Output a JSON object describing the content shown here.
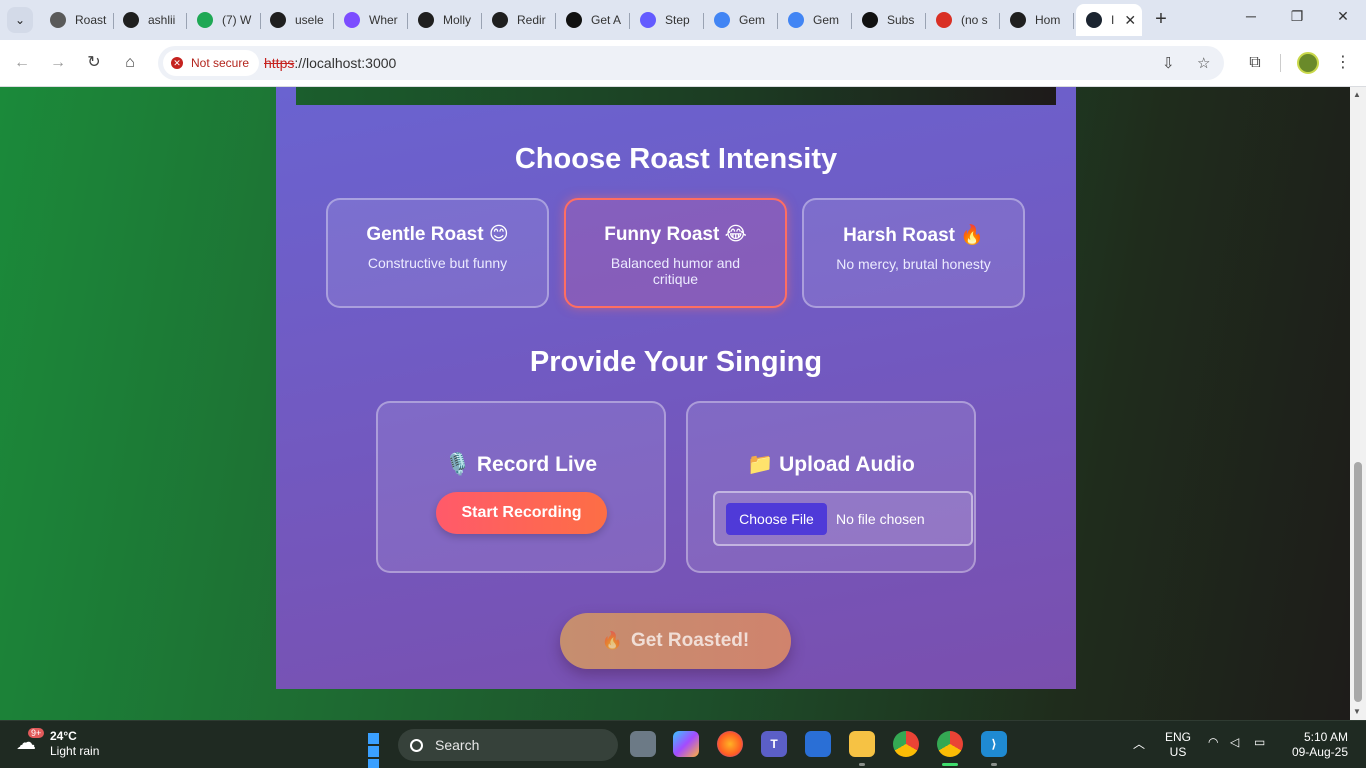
{
  "browser": {
    "tabs": [
      {
        "label": "Roast",
        "icon": "openai-icon",
        "color": "#5a5a5a"
      },
      {
        "label": "ashlii",
        "icon": "github-icon",
        "color": "#1f1f1f"
      },
      {
        "label": "(7) W",
        "icon": "whatsapp-icon",
        "color": "#1fa855"
      },
      {
        "label": "usele",
        "icon": "github-icon",
        "color": "#1f1f1f"
      },
      {
        "label": "Wher",
        "icon": "cursor-icon",
        "color": "#7c4dff"
      },
      {
        "label": "Molly",
        "icon": "spotify-icon",
        "color": "#1f1f1f"
      },
      {
        "label": "Redir",
        "icon": "spotify-icon",
        "color": "#1f1f1f"
      },
      {
        "label": "Get A",
        "icon": "get-icon",
        "color": "#111111"
      },
      {
        "label": "Step",
        "icon": "stripe-icon",
        "color": "#635bff"
      },
      {
        "label": "Gem",
        "icon": "google-icon",
        "color": "#4285f4"
      },
      {
        "label": "Gem",
        "icon": "google-icon",
        "color": "#4285f4"
      },
      {
        "label": "Subs",
        "icon": "substack-icon",
        "color": "#111111"
      },
      {
        "label": "(no s",
        "icon": "gmail-icon",
        "color": "#d93025"
      },
      {
        "label": "Hom",
        "icon": "spotify-icon",
        "color": "#1f1f1f"
      },
      {
        "label": "I",
        "icon": "react-icon",
        "color": "#1b2430",
        "active": true
      }
    ],
    "security_chip": "Not secure",
    "url_scheme": "https",
    "url_rest": "://localhost:3000"
  },
  "page": {
    "intensity_title": "Choose Roast Intensity",
    "intensity_options": [
      {
        "name": "Gentle Roast",
        "emoji": "😊",
        "desc": "Constructive but funny",
        "selected": false
      },
      {
        "name": "Funny Roast",
        "emoji": "😂",
        "desc": "Balanced humor and critique",
        "selected": true
      },
      {
        "name": "Harsh Roast",
        "emoji": "🔥",
        "desc": "No mercy, brutal honesty",
        "selected": false
      }
    ],
    "singing_title": "Provide Your Singing",
    "record": {
      "emoji": "🎙️",
      "title": "Record Live",
      "button": "Start Recording"
    },
    "upload": {
      "emoji": "📁",
      "title": "Upload Audio",
      "file_button": "Choose File",
      "file_status": "No file chosen"
    },
    "submit": {
      "emoji": "🔥",
      "label": "Get Roasted!"
    }
  },
  "taskbar": {
    "weather_badge": "9+",
    "temperature": "24°C",
    "condition": "Light rain",
    "search_placeholder": "Search",
    "lang_top": "ENG",
    "lang_bottom": "US",
    "time": "5:10 AM",
    "date": "09-Aug-25"
  }
}
